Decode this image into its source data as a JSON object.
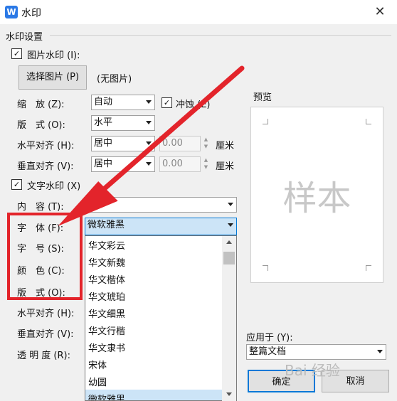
{
  "window": {
    "icon": "W",
    "title": "水印",
    "close_glyph": "✕"
  },
  "group_title": "水印设置",
  "picture_watermark": {
    "checked": true,
    "check_glyph": "✓",
    "label": "图片水印 (I):",
    "select_button": "选择图片 (P)",
    "no_picture": "(无图片)",
    "scale_label": "缩　放 (Z):",
    "scale_value": "自动",
    "washout_checked": true,
    "washout_label": "冲蚀 (E)",
    "layout_label": "版　式 (O):",
    "layout_value": "水平",
    "halign_label": "水平对齐 (H):",
    "halign_value": "居中",
    "halign_offset": "0.00",
    "halign_unit": "厘米",
    "valign_label": "垂直对齐 (V):",
    "valign_value": "居中",
    "valign_offset": "0.00",
    "valign_unit": "厘米"
  },
  "text_watermark": {
    "checked": true,
    "label": "文字水印 (X)",
    "content_label": "内　容 (T):",
    "content_value": "样本",
    "font_label": "字　体 (F):",
    "font_value": "微软雅黑",
    "size_label": "字　号 (S):",
    "color_label": "颜　色 (C):",
    "layout_label": "版　式 (O):",
    "halign_label": "水平对齐 (H):",
    "valign_label": "垂直对齐 (V):",
    "transparency_label": "透 明 度 (R):"
  },
  "font_options": [
    "华文彩云",
    "华文新魏",
    "华文楷体",
    "华文琥珀",
    "华文细黑",
    "华文行楷",
    "华文隶书",
    "宋体",
    "幼圆",
    "微软雅黑"
  ],
  "preview": {
    "label": "预览",
    "sample_text": "样本"
  },
  "apply_to": {
    "label": "应用于 (Y):",
    "value": "整篇文档"
  },
  "buttons": {
    "ok": "确定",
    "cancel": "取消"
  },
  "overlay_watermark": "Bai 经验",
  "colors": {
    "annotation_red": "#e3242b",
    "selection_blue": "#cce4f7",
    "wps_blue": "#2b79e6"
  }
}
